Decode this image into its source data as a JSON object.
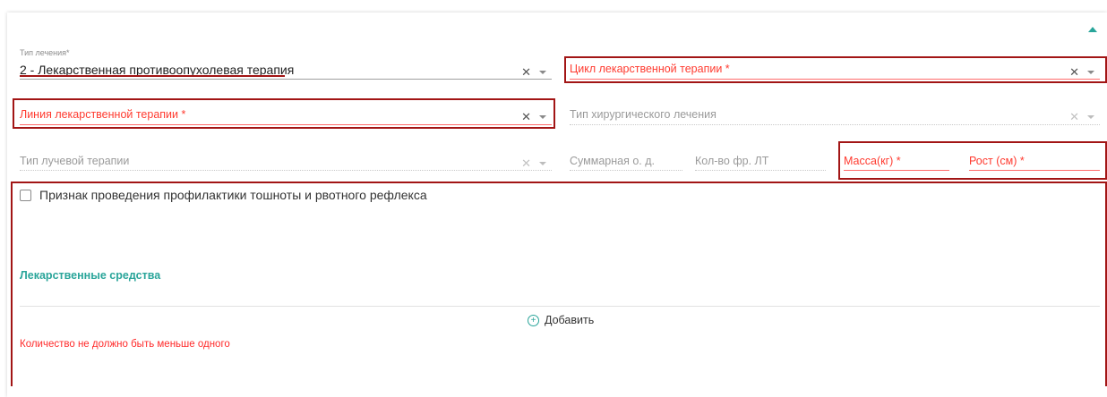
{
  "form": {
    "collapse_icon": "chevron-up-icon",
    "accent_color": "#2aa59a",
    "error_color": "#ff2b2b",
    "treatment_type": {
      "label": "Тип лечения*",
      "value": "2 - Лекарственная противоопухолевая терапия"
    },
    "drug_cycle": {
      "placeholder": "Цикл лекарственной терапии *"
    },
    "drug_line": {
      "placeholder": "Линия лекарственной терапии *"
    },
    "surgery_type": {
      "placeholder": "Тип хирургического лечения"
    },
    "radiation_type": {
      "placeholder": "Тип лучевой терапии"
    },
    "total_dose": {
      "placeholder": "Суммарная о. д."
    },
    "fractions": {
      "placeholder": "Кол-во фр. ЛТ"
    },
    "weight": {
      "placeholder": "Масса(кг) *"
    },
    "height": {
      "placeholder": "Рост (см) *"
    },
    "nausea_prophylaxis": {
      "label": "Признак проведения профилактики тошноты и рвотного рефлекса",
      "checked": false
    },
    "medications": {
      "title": "Лекарственные средства",
      "add_label": "Добавить",
      "error": "Количество не должно быть меньше одного"
    }
  }
}
